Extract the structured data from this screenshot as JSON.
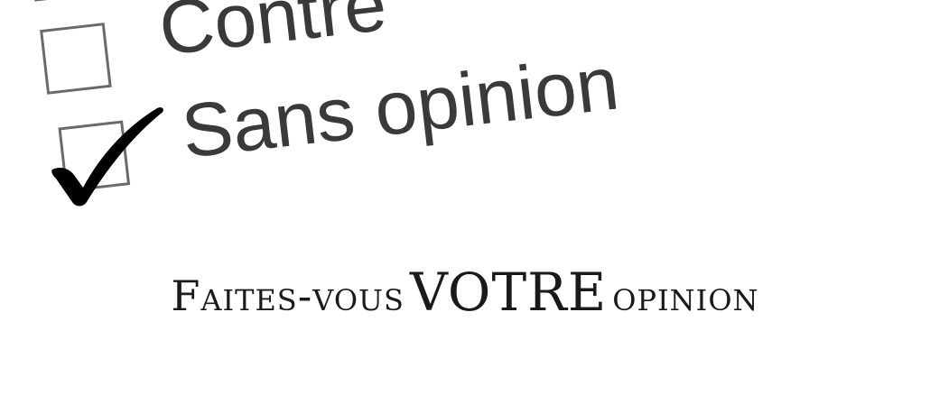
{
  "ballot": {
    "options": [
      {
        "label": "Contre",
        "checked": false
      },
      {
        "label": "Sans opinion",
        "checked": true
      }
    ],
    "check_icon": "checkmark-icon",
    "colors": {
      "box_border": "#6a6a6a",
      "label_text": "#3a3a3a",
      "checkmark": "#000000"
    }
  },
  "tagline": {
    "prefix": "Faites-vous",
    "emphasis": "VOTRE",
    "suffix": "opinion",
    "color": "#1a1a1a"
  }
}
